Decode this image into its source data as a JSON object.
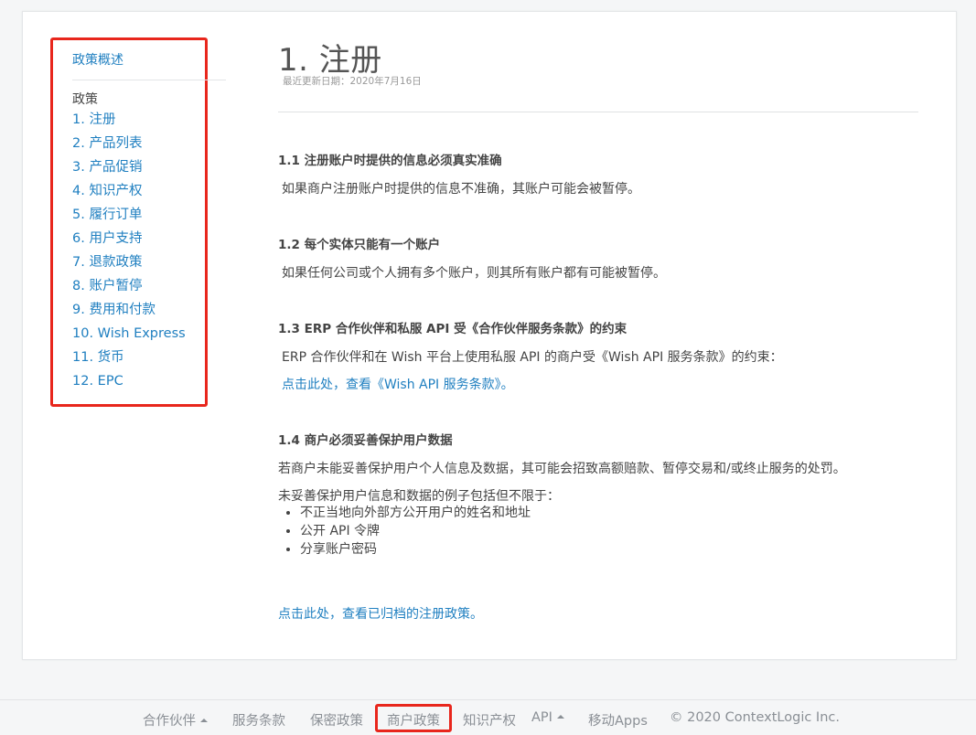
{
  "sidebar": {
    "overview": "政策概述",
    "heading": "政策",
    "items": [
      {
        "label": "1. 注册"
      },
      {
        "label": "2. 产品列表"
      },
      {
        "label": "3. 产品促销"
      },
      {
        "label": "4. 知识产权"
      },
      {
        "label": "5. 履行订单"
      },
      {
        "label": "6. 用户支持"
      },
      {
        "label": "7. 退款政策"
      },
      {
        "label": "8. 账户暂停"
      },
      {
        "label": "9. 费用和付款"
      },
      {
        "label": "10. Wish Express"
      },
      {
        "label": "11. 货币"
      },
      {
        "label": "12. EPC"
      }
    ]
  },
  "main": {
    "title": "1. 注册",
    "updated": "最近更新日期：2020年7月16日",
    "sections": [
      {
        "title": "1.1 注册账户时提供的信息必须真实准确",
        "body": "如果商户注册账户时提供的信息不准确，其账户可能会被暂停。"
      },
      {
        "title": "1.2 每个实体只能有一个账户",
        "body": "如果任何公司或个人拥有多个账户，则其所有账户都有可能被暂停。"
      },
      {
        "title": "1.3 ERP 合作伙伴和私服 API 受《合作伙伴服务条款》的约束",
        "body": "ERP 合作伙伴和在 Wish 平台上使用私服 API 的商户受《Wish API 服务条款》的约束：",
        "link": "点击此处，查看《Wish API 服务条款》。"
      },
      {
        "title": "1.4 商户必须妥善保护用户数据",
        "body": "若商户未能妥善保护用户个人信息及数据，其可能会招致高额赔款、暂停交易和/或终止服务的处罚。",
        "body2": "未妥善保护用户信息和数据的例子包括但不限于：",
        "bullets": [
          "不正当地向外部方公开用户的姓名和地址",
          "公开 API 令牌",
          "分享账户密码"
        ]
      }
    ],
    "archive_link": "点击此处，查看已归档的注册政策。"
  },
  "footer": {
    "partners": "合作伙伴",
    "terms": "服务条款",
    "privacy": "保密政策",
    "merchant_policy": "商户政策",
    "ip": "知识产权",
    "api": "API",
    "mobile": "移动Apps",
    "copyright": "© 2020 ContextLogic Inc."
  },
  "colors": {
    "link": "#1f7fc0",
    "highlight": "#e8261c",
    "footer_text": "#8a8f95"
  }
}
